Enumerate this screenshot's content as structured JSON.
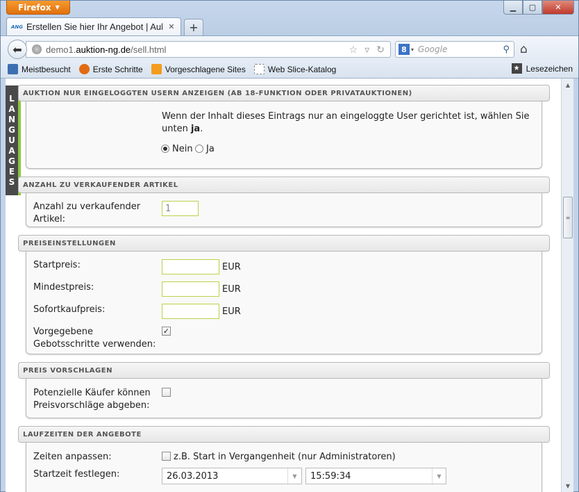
{
  "browser": {
    "app_button": "Firefox",
    "tab_favicon": "ANG",
    "tab_title": "Erstellen Sie hier Ihr Angebot | Auktion:N...",
    "url_prefix": "demo1.",
    "url_host": "auktion-ng.de",
    "url_path": "/sell.html",
    "search_engine_letter": "8",
    "search_placeholder": "Google",
    "bookmarks": [
      {
        "label": "Meistbesucht",
        "icon": "bookmark-page-icon",
        "color": "#3c6fb0"
      },
      {
        "label": "Erste Schritte",
        "icon": "firefox-icon",
        "color": "#e26b12"
      },
      {
        "label": "Vorgeschlagene Sites",
        "icon": "suggested-sites-icon",
        "color": "#f39c1d"
      },
      {
        "label": "Web Slice-Katalog",
        "icon": "web-slice-icon",
        "color": "#cccccc"
      }
    ],
    "bookmarks_menu": "Lesezeichen"
  },
  "sidebar": {
    "letters": [
      "L",
      "A",
      "N",
      "G",
      "U",
      "A",
      "G",
      "E",
      "S"
    ]
  },
  "sections": {
    "login_only": {
      "header": "AUKTION NUR EINGELOGGTEN USERN ANZEIGEN (AB 18-FUNKTION ODER PRIVATAUKTIONEN)",
      "description_line1": "Wenn der Inhalt dieses Eintrags nur an eingeloggte User gerichtet ist, wählen Sie",
      "description_line2_prefix": "unten ",
      "description_line2_bold": "ja",
      "description_line2_suffix": ".",
      "option_no": "Nein",
      "option_yes": "Ja",
      "selected": "Nein"
    },
    "quantity": {
      "header": "ANZAHL ZU VERKAUFENDER ARTIKEL",
      "label_line1": "Anzahl zu verkaufender",
      "label_line2": "Artikel:",
      "value": "1"
    },
    "prices": {
      "header": "PREISEINSTELLUNGEN",
      "start_label": "Startpreis:",
      "min_label": "Mindestpreis:",
      "buynow_label": "Sofortkaufpreis:",
      "currency": "EUR",
      "increments_label_line1": "Vorgegebene",
      "increments_label_line2": "Gebotsschritte verwenden:",
      "increments_checked": true
    },
    "offers": {
      "header": "PREIS VORSCHLAGEN",
      "label_line1": "Potenzielle Käufer können",
      "label_line2": "Preisvorschläge abgeben:",
      "checked": false
    },
    "durations": {
      "header": "LAUFZEITEN DER ANGEBOTE",
      "adjust_label": "Zeiten anpassen:",
      "adjust_option": "z.B. Start in Vergangenheit (nur Administratoren)",
      "start_label": "Startzeit festlegen:",
      "start_date": "26.03.2013",
      "start_time": "15:59:34"
    }
  }
}
